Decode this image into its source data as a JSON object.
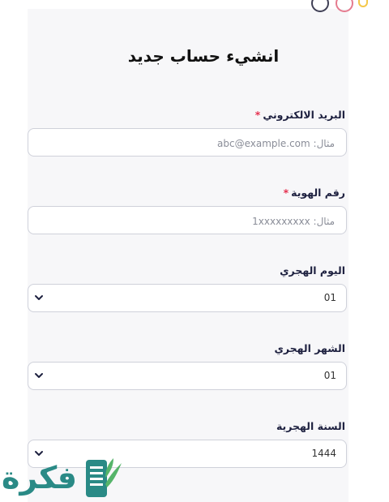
{
  "form": {
    "title": "انشيء حساب جديد",
    "email": {
      "label": "البريد الالكتروني",
      "required_mark": "*",
      "placeholder": "مثال: abc@example.com"
    },
    "id_number": {
      "label": "رقم الهوية",
      "required_mark": "*",
      "placeholder": "مثال: 1xxxxxxxxx"
    },
    "hijri_day": {
      "label": "اليوم الهجري",
      "value": "01"
    },
    "hijri_month": {
      "label": "الشهر الهجري",
      "value": "01"
    },
    "hijri_year": {
      "label": "السنة الهجرية",
      "value": "1444"
    }
  },
  "watermark": {
    "text": "فكرة"
  },
  "colors": {
    "accent": "#1e2140",
    "required": "#e5304f",
    "watermark": "#2a8a86"
  }
}
